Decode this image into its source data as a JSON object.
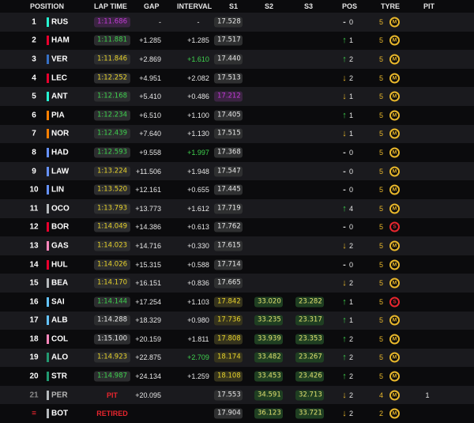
{
  "headers": {
    "position": "POSITION",
    "lap_time": "LAP TIME",
    "gap": "GAP",
    "interval": "INTERVAL",
    "s1": "S1",
    "s2": "S2",
    "s3": "S3",
    "pos": "POS",
    "tyre": "TYRE",
    "pit": "PIT"
  },
  "colors": {
    "mercedes": "#27f4d2",
    "red_bull": "#3671c6",
    "ferrari": "#e8002d",
    "mclaren": "#ff8000",
    "racing_bulls": "#6692ff",
    "alpine": "#ff87bc",
    "sauber": "#52e252",
    "haas": "#b6babd",
    "williams": "#64c4ff",
    "aston_martin": "#229971"
  },
  "rows": [
    {
      "pos": "1",
      "code": "RUS",
      "team": "#27f4d2",
      "lap": "1:11.686",
      "lap_style": "purple",
      "gap": "-",
      "interval": "-",
      "interval_style": "",
      "s1": "17.528",
      "s1_style": "",
      "s2": "",
      "s3": "",
      "arrow": "none",
      "change": "0",
      "laps": "5",
      "tyre": "M",
      "pit": ""
    },
    {
      "pos": "2",
      "code": "HAM",
      "team": "#e8002d",
      "lap": "1:11.881",
      "lap_style": "green",
      "gap": "+1.285",
      "interval": "+1.285",
      "interval_style": "",
      "s1": "17.517",
      "s1_style": "",
      "s2": "",
      "s3": "",
      "arrow": "up",
      "change": "1",
      "laps": "5",
      "tyre": "M",
      "pit": ""
    },
    {
      "pos": "3",
      "code": "VER",
      "team": "#3671c6",
      "lap": "1:11.846",
      "lap_style": "yellow",
      "gap": "+2.869",
      "interval": "+1.610",
      "interval_style": "green",
      "s1": "17.440",
      "s1_style": "",
      "s2": "",
      "s3": "",
      "arrow": "up",
      "change": "2",
      "laps": "5",
      "tyre": "M",
      "pit": ""
    },
    {
      "pos": "4",
      "code": "LEC",
      "team": "#e8002d",
      "lap": "1:12.252",
      "lap_style": "yellow",
      "gap": "+4.951",
      "interval": "+2.082",
      "interval_style": "",
      "s1": "17.513",
      "s1_style": "",
      "s2": "",
      "s3": "",
      "arrow": "down",
      "change": "2",
      "laps": "5",
      "tyre": "M",
      "pit": ""
    },
    {
      "pos": "5",
      "code": "ANT",
      "team": "#27f4d2",
      "lap": "1:12.168",
      "lap_style": "green",
      "gap": "+5.410",
      "interval": "+0.486",
      "interval_style": "",
      "s1": "17.212",
      "s1_style": "purple",
      "s2": "",
      "s3": "",
      "arrow": "down",
      "change": "1",
      "laps": "5",
      "tyre": "M",
      "pit": ""
    },
    {
      "pos": "6",
      "code": "PIA",
      "team": "#ff8000",
      "lap": "1:12.234",
      "lap_style": "green",
      "gap": "+6.510",
      "interval": "+1.100",
      "interval_style": "",
      "s1": "17.405",
      "s1_style": "",
      "s2": "",
      "s3": "",
      "arrow": "up",
      "change": "1",
      "laps": "5",
      "tyre": "M",
      "pit": ""
    },
    {
      "pos": "7",
      "code": "NOR",
      "team": "#ff8000",
      "lap": "1:12.439",
      "lap_style": "green",
      "gap": "+7.640",
      "interval": "+1.130",
      "interval_style": "",
      "s1": "17.515",
      "s1_style": "",
      "s2": "",
      "s3": "",
      "arrow": "down",
      "change": "1",
      "laps": "5",
      "tyre": "M",
      "pit": ""
    },
    {
      "pos": "8",
      "code": "HAD",
      "team": "#6692ff",
      "lap": "1:12.593",
      "lap_style": "green",
      "gap": "+9.558",
      "interval": "+1.997",
      "interval_style": "green",
      "s1": "17.368",
      "s1_style": "",
      "s2": "",
      "s3": "",
      "arrow": "none",
      "change": "0",
      "laps": "5",
      "tyre": "M",
      "pit": ""
    },
    {
      "pos": "9",
      "code": "LAW",
      "team": "#6692ff",
      "lap": "1:13.224",
      "lap_style": "yellow",
      "gap": "+11.506",
      "interval": "+1.948",
      "interval_style": "",
      "s1": "17.547",
      "s1_style": "",
      "s2": "",
      "s3": "",
      "arrow": "none",
      "change": "0",
      "laps": "5",
      "tyre": "M",
      "pit": ""
    },
    {
      "pos": "10",
      "code": "LIN",
      "team": "#6692ff",
      "lap": "1:13.520",
      "lap_style": "yellow",
      "gap": "+12.161",
      "interval": "+0.655",
      "interval_style": "",
      "s1": "17.445",
      "s1_style": "",
      "s2": "",
      "s3": "",
      "arrow": "none",
      "change": "0",
      "laps": "5",
      "tyre": "M",
      "pit": ""
    },
    {
      "pos": "11",
      "code": "OCO",
      "team": "#b6babd",
      "lap": "1:13.793",
      "lap_style": "yellow",
      "gap": "+13.773",
      "interval": "+1.612",
      "interval_style": "",
      "s1": "17.719",
      "s1_style": "",
      "s2": "",
      "s3": "",
      "arrow": "up",
      "change": "4",
      "laps": "5",
      "tyre": "M",
      "pit": ""
    },
    {
      "pos": "12",
      "code": "BOR",
      "team": "#e8002d",
      "lap": "1:14.049",
      "lap_style": "yellow",
      "gap": "+14.386",
      "interval": "+0.613",
      "interval_style": "",
      "s1": "17.762",
      "s1_style": "",
      "s2": "",
      "s3": "",
      "arrow": "none",
      "change": "0",
      "laps": "5",
      "tyre": "S",
      "pit": ""
    },
    {
      "pos": "13",
      "code": "GAS",
      "team": "#ff87bc",
      "lap": "1:14.023",
      "lap_style": "yellow",
      "gap": "+14.716",
      "interval": "+0.330",
      "interval_style": "",
      "s1": "17.615",
      "s1_style": "",
      "s2": "",
      "s3": "",
      "arrow": "down",
      "change": "2",
      "laps": "5",
      "tyre": "M",
      "pit": ""
    },
    {
      "pos": "14",
      "code": "HUL",
      "team": "#e8002d",
      "lap": "1:14.026",
      "lap_style": "yellow",
      "gap": "+15.315",
      "interval": "+0.588",
      "interval_style": "",
      "s1": "17.714",
      "s1_style": "",
      "s2": "",
      "s3": "",
      "arrow": "none",
      "change": "0",
      "laps": "5",
      "tyre": "M",
      "pit": ""
    },
    {
      "pos": "15",
      "code": "BEA",
      "team": "#b6babd",
      "lap": "1:14.170",
      "lap_style": "yellow",
      "gap": "+16.151",
      "interval": "+0.836",
      "interval_style": "",
      "s1": "17.665",
      "s1_style": "",
      "s2": "",
      "s3": "",
      "arrow": "down",
      "change": "2",
      "laps": "5",
      "tyre": "M",
      "pit": ""
    },
    {
      "pos": "16",
      "code": "SAI",
      "team": "#64c4ff",
      "lap": "1:14.144",
      "lap_style": "green",
      "gap": "+17.254",
      "interval": "+1.103",
      "interval_style": "",
      "s1": "17.842",
      "s1_style": "yellow",
      "s2": "33.020",
      "s3": "23.282",
      "arrow": "up",
      "change": "1",
      "laps": "5",
      "tyre": "S",
      "pit": ""
    },
    {
      "pos": "17",
      "code": "ALB",
      "team": "#64c4ff",
      "lap": "1:14.288",
      "lap_style": "white",
      "gap": "+18.329",
      "interval": "+0.980",
      "interval_style": "",
      "s1": "17.736",
      "s1_style": "yellow",
      "s2": "33.235",
      "s3": "23.317",
      "arrow": "up",
      "change": "1",
      "laps": "5",
      "tyre": "M",
      "pit": ""
    },
    {
      "pos": "18",
      "code": "COL",
      "team": "#ff87bc",
      "lap": "1:15.100",
      "lap_style": "white",
      "gap": "+20.159",
      "interval": "+1.811",
      "interval_style": "",
      "s1": "17.808",
      "s1_style": "yellow",
      "s2": "33.939",
      "s3": "23.353",
      "arrow": "up",
      "change": "2",
      "laps": "5",
      "tyre": "M",
      "pit": ""
    },
    {
      "pos": "19",
      "code": "ALO",
      "team": "#229971",
      "lap": "1:14.923",
      "lap_style": "yellow",
      "gap": "+22.875",
      "interval": "+2.709",
      "interval_style": "green",
      "s1": "18.174",
      "s1_style": "yellow",
      "s2": "33.482",
      "s3": "23.267",
      "arrow": "up",
      "change": "2",
      "laps": "5",
      "tyre": "M",
      "pit": ""
    },
    {
      "pos": "20",
      "code": "STR",
      "team": "#229971",
      "lap": "1:14.987",
      "lap_style": "green",
      "gap": "+24.134",
      "interval": "+1.259",
      "interval_style": "",
      "s1": "18.108",
      "s1_style": "yellow",
      "s2": "33.453",
      "s3": "23.426",
      "arrow": "up",
      "change": "2",
      "laps": "5",
      "tyre": "M",
      "pit": ""
    },
    {
      "pos": "21",
      "code": "PER",
      "team": "#b6babd",
      "status": "PIT",
      "gap": "+20.095",
      "interval": "",
      "interval_style": "",
      "s1": "17.553",
      "s1_style": "",
      "s2": "34.591",
      "s3": "32.713",
      "arrow": "down",
      "change": "2",
      "laps": "4",
      "tyre": "M",
      "pit": "1",
      "dim": true
    },
    {
      "pos": "",
      "code": "BOT",
      "team": "#b6babd",
      "status": "RETIRED",
      "gap": "",
      "interval": "",
      "interval_style": "",
      "s1": "17.904",
      "s1_style": "",
      "s2": "36.123",
      "s3": "33.721",
      "arrow": "down",
      "change": "2",
      "laps": "2",
      "tyre": "M",
      "pit": "",
      "retired": true
    }
  ]
}
